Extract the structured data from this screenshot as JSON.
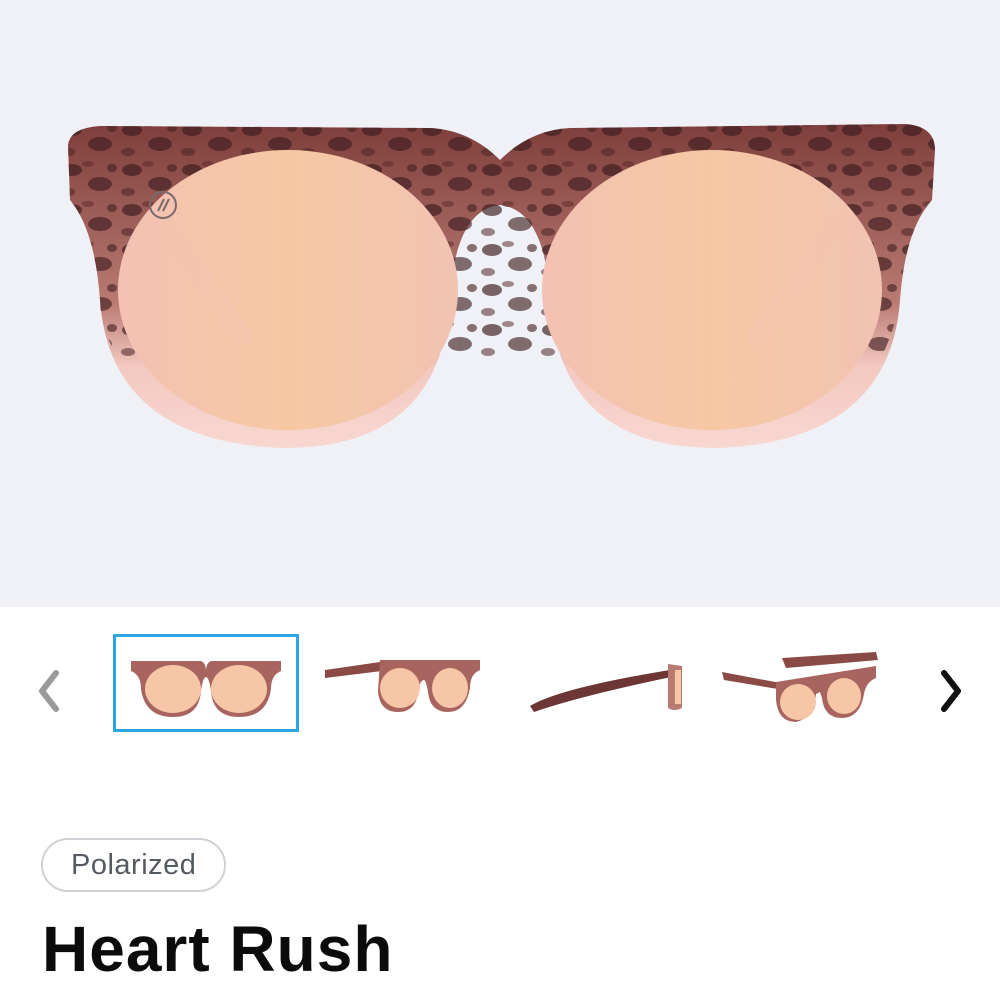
{
  "product": {
    "badge": "Polarized",
    "name": "Heart Rush"
  },
  "gallery": {
    "selected_index": 0,
    "thumbnails": [
      {
        "view": "front"
      },
      {
        "view": "front-angled"
      },
      {
        "view": "side"
      },
      {
        "view": "three-quarter"
      }
    ],
    "prev_icon": "chevron-left-icon",
    "next_icon": "chevron-right-icon"
  },
  "colors": {
    "hero_background": "#eff1f6",
    "selected_border": "#2aa7e0",
    "frame_tortoise": "#8a4a46",
    "frame_pink": "#f6ccc4",
    "lens": "#f6c6a6",
    "prev_arrow": "#9a9a9a",
    "next_arrow": "#111111"
  }
}
